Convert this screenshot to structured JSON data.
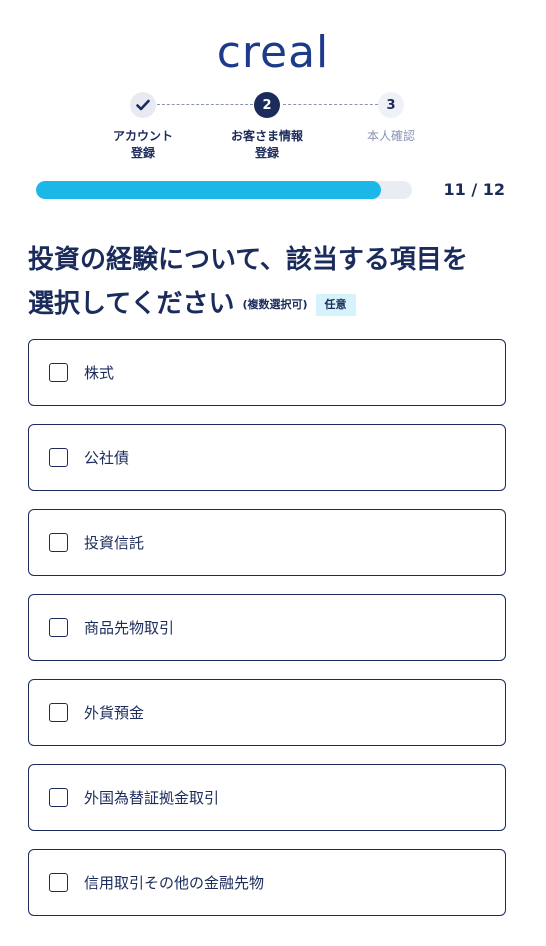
{
  "brand": {
    "logo": "creal"
  },
  "stepper": {
    "steps": [
      {
        "number": "",
        "label_line1": "アカウント",
        "label_line2": "登録",
        "state": "done",
        "icon": "check-icon"
      },
      {
        "number": "2",
        "label_line1": "お客さま情報",
        "label_line2": "登録",
        "state": "current"
      },
      {
        "number": "3",
        "label_line1": "本人確認",
        "label_line2": "",
        "state": "todo"
      }
    ]
  },
  "progress": {
    "text": "11 / 12",
    "current": 11,
    "total": 12,
    "fraction": 0.917
  },
  "question": {
    "line1": "投資の経験について、該当する項目を",
    "line2": "選択してください",
    "note": "(複数選択可)",
    "badge": "任意"
  },
  "options": [
    {
      "label": "株式",
      "checked": false
    },
    {
      "label": "公社債",
      "checked": false
    },
    {
      "label": "投資信託",
      "checked": false
    },
    {
      "label": "商品先物取引",
      "checked": false
    },
    {
      "label": "外貨預金",
      "checked": false
    },
    {
      "label": "外国為替証拠金取引",
      "checked": false
    },
    {
      "label": "信用取引その他の金融先物",
      "checked": false
    }
  ],
  "colors": {
    "navy": "#1b2b5b",
    "accent": "#1bb7e6",
    "badge_bg": "#d6f2fb"
  }
}
